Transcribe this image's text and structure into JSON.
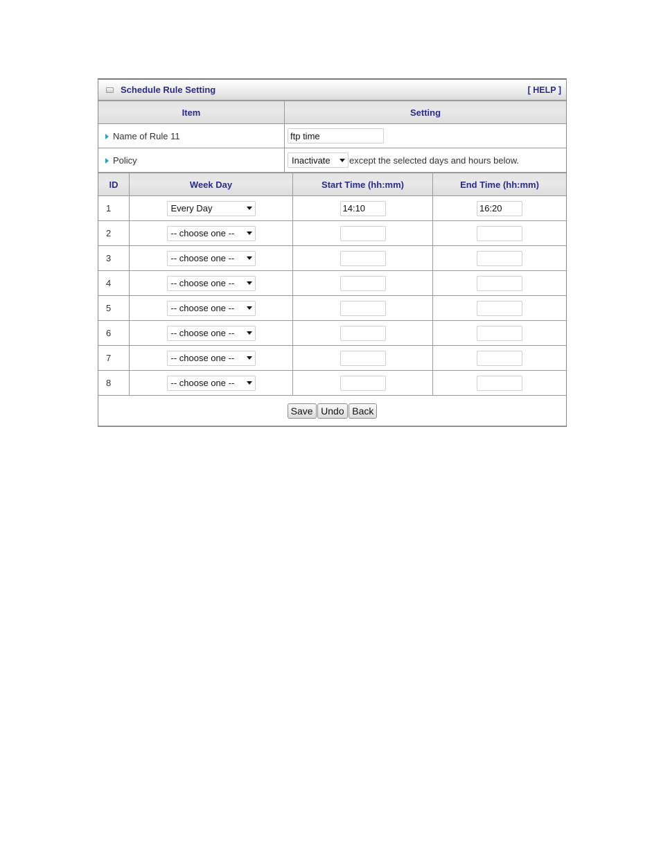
{
  "panel": {
    "title": "Schedule Rule Setting",
    "help_label": "[ HELP ]",
    "icon": "panel-icon"
  },
  "item_table": {
    "headers": {
      "item": "Item",
      "setting": "Setting"
    },
    "name_label": "Name of Rule 11",
    "name_value": "ftp time",
    "policy_label": "Policy",
    "policy_value": "Inactivate",
    "policy_suffix": "except the selected days and hours below."
  },
  "schedule": {
    "headers": {
      "id": "ID",
      "week_day": "Week Day",
      "start": "Start Time (hh:mm)",
      "end": "End Time (hh:mm)"
    },
    "rows": [
      {
        "id": "1",
        "week_day": "Every Day",
        "start": "14:10",
        "end": "16:20"
      },
      {
        "id": "2",
        "week_day": "-- choose one --",
        "start": "",
        "end": ""
      },
      {
        "id": "3",
        "week_day": "-- choose one --",
        "start": "",
        "end": ""
      },
      {
        "id": "4",
        "week_day": "-- choose one --",
        "start": "",
        "end": ""
      },
      {
        "id": "5",
        "week_day": "-- choose one --",
        "start": "",
        "end": ""
      },
      {
        "id": "6",
        "week_day": "-- choose one --",
        "start": "",
        "end": ""
      },
      {
        "id": "7",
        "week_day": "-- choose one --",
        "start": "",
        "end": ""
      },
      {
        "id": "8",
        "week_day": "-- choose one --",
        "start": "",
        "end": ""
      }
    ]
  },
  "buttons": {
    "save": "Save",
    "undo": "Undo",
    "back": "Back"
  },
  "colors": {
    "header_text": "#2b2b8a",
    "arrow": "#2aa3c0",
    "border": "#9a9a9a"
  }
}
